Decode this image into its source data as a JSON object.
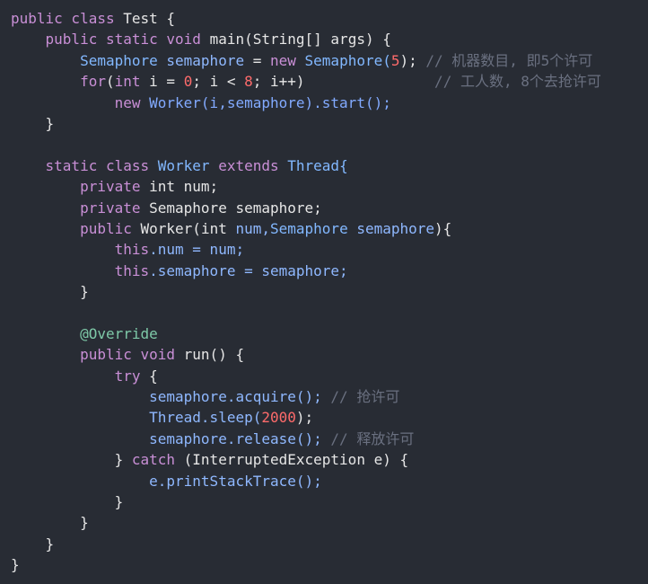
{
  "code": {
    "lines": [
      [
        {
          "t": "public class ",
          "c": "kw"
        },
        {
          "t": "Test {",
          "c": "ty"
        }
      ],
      [
        {
          "t": "    public static void ",
          "c": "kw"
        },
        {
          "t": "main(String[] args) {",
          "c": "ty"
        }
      ],
      [
        {
          "t": "        Semaphore ",
          "c": "cls"
        },
        {
          "t": "semaphore",
          "c": "var"
        },
        {
          "t": " = ",
          "c": "pn"
        },
        {
          "t": "new ",
          "c": "kw"
        },
        {
          "t": "Semaphore(",
          "c": "cls"
        },
        {
          "t": "5",
          "c": "num"
        },
        {
          "t": "); ",
          "c": "pn"
        },
        {
          "t": "// 机器数目, 即5个许可",
          "c": "cm"
        }
      ],
      [
        {
          "t": "        for",
          "c": "kw"
        },
        {
          "t": "(",
          "c": "pn"
        },
        {
          "t": "int",
          "c": "kw"
        },
        {
          "t": " i = ",
          "c": "ty"
        },
        {
          "t": "0",
          "c": "num"
        },
        {
          "t": "; i < ",
          "c": "ty"
        },
        {
          "t": "8",
          "c": "num"
        },
        {
          "t": "; i++)",
          "c": "ty"
        },
        {
          "t": "               // 工人数, 8个去抢许可",
          "c": "cm"
        }
      ],
      [
        {
          "t": "            new ",
          "c": "kw"
        },
        {
          "t": "Worker(i,semaphore).start();",
          "c": "fn"
        }
      ],
      [
        {
          "t": "    }",
          "c": "pn"
        }
      ],
      [
        {
          "t": "",
          "c": "pn"
        }
      ],
      [
        {
          "t": "    static class ",
          "c": "kw"
        },
        {
          "t": "Worker ",
          "c": "cls"
        },
        {
          "t": "extends ",
          "c": "kw"
        },
        {
          "t": "Thread{",
          "c": "cls"
        }
      ],
      [
        {
          "t": "        private ",
          "c": "kw"
        },
        {
          "t": "int num;",
          "c": "ty"
        }
      ],
      [
        {
          "t": "        private ",
          "c": "kw"
        },
        {
          "t": "Semaphore semaphore;",
          "c": "ty"
        }
      ],
      [
        {
          "t": "        public ",
          "c": "kw"
        },
        {
          "t": "Worker(",
          "c": "ty"
        },
        {
          "t": "int ",
          "c": "ty"
        },
        {
          "t": "num,",
          "c": "var"
        },
        {
          "t": "Semaphore ",
          "c": "cls"
        },
        {
          "t": "semaphore",
          "c": "var"
        },
        {
          "t": "){",
          "c": "pn"
        }
      ],
      [
        {
          "t": "            this",
          "c": "kw"
        },
        {
          "t": ".num = num;",
          "c": "var"
        }
      ],
      [
        {
          "t": "            this",
          "c": "kw"
        },
        {
          "t": ".semaphore = semaphore;",
          "c": "var"
        }
      ],
      [
        {
          "t": "        }",
          "c": "pn"
        }
      ],
      [
        {
          "t": "",
          "c": "pn"
        }
      ],
      [
        {
          "t": "        @Override",
          "c": "an"
        }
      ],
      [
        {
          "t": "        public void ",
          "c": "kw"
        },
        {
          "t": "run() {",
          "c": "ty"
        }
      ],
      [
        {
          "t": "            try ",
          "c": "kw"
        },
        {
          "t": "{",
          "c": "pn"
        }
      ],
      [
        {
          "t": "                semaphore.acquire(); ",
          "c": "var"
        },
        {
          "t": "// 抢许可",
          "c": "cm"
        }
      ],
      [
        {
          "t": "                Thread.sleep(",
          "c": "var"
        },
        {
          "t": "2000",
          "c": "num"
        },
        {
          "t": ");",
          "c": "pn"
        }
      ],
      [
        {
          "t": "                semaphore.release(); ",
          "c": "var"
        },
        {
          "t": "// 释放许可",
          "c": "cm"
        }
      ],
      [
        {
          "t": "            } ",
          "c": "pn"
        },
        {
          "t": "catch ",
          "c": "kw"
        },
        {
          "t": "(InterruptedException e) {",
          "c": "ty"
        }
      ],
      [
        {
          "t": "                e.printStackTrace();",
          "c": "var"
        }
      ],
      [
        {
          "t": "            }",
          "c": "pn"
        }
      ],
      [
        {
          "t": "        }",
          "c": "pn"
        }
      ],
      [
        {
          "t": "    }",
          "c": "pn"
        }
      ],
      [
        {
          "t": "}",
          "c": "pn"
        }
      ]
    ]
  },
  "colors": {
    "background": "#282c34",
    "keyword": "#c98fd6",
    "class": "#82b8ff",
    "number": "#ff6b6b",
    "comment": "#6a7080"
  }
}
